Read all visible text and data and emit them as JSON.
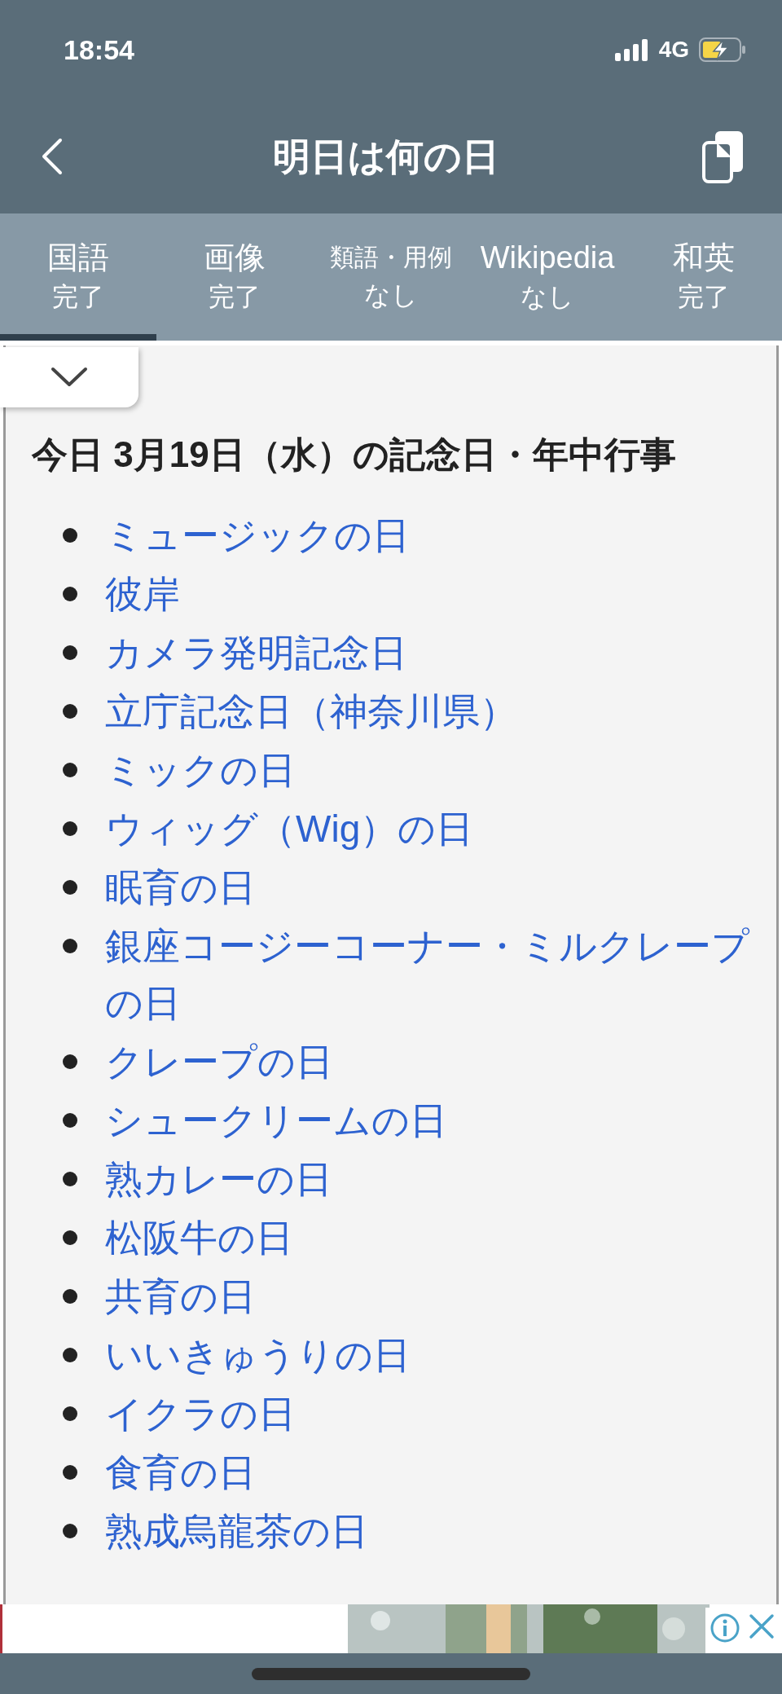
{
  "status_bar": {
    "time": "18:54",
    "network": "4G"
  },
  "header": {
    "title": "明日は何の日"
  },
  "tabs": [
    {
      "label": "国語",
      "status": "完了",
      "selected": true
    },
    {
      "label": "画像",
      "status": "完了",
      "selected": false
    },
    {
      "label": "類語・用例",
      "status": "なし",
      "selected": false
    },
    {
      "label": "Wikipedia",
      "status": "なし",
      "selected": false
    },
    {
      "label": "和英",
      "status": "完了",
      "selected": false
    }
  ],
  "panel": {
    "heading": "今日 3月19日（水）の記念日・年中行事",
    "items": [
      "ミュージックの日",
      "彼岸",
      "カメラ発明記念日",
      "立庁記念日（神奈川県）",
      "ミックの日",
      "ウィッグ（Wig）の日",
      "眠育の日",
      "銀座コージーコーナー・ミルクレープの日",
      "クレープの日",
      "シュークリームの日",
      "熟カレーの日",
      "松阪牛の日",
      "共育の日",
      "いいきゅうりの日",
      "イクラの日",
      "食育の日",
      "熟成烏龍茶の日"
    ]
  }
}
